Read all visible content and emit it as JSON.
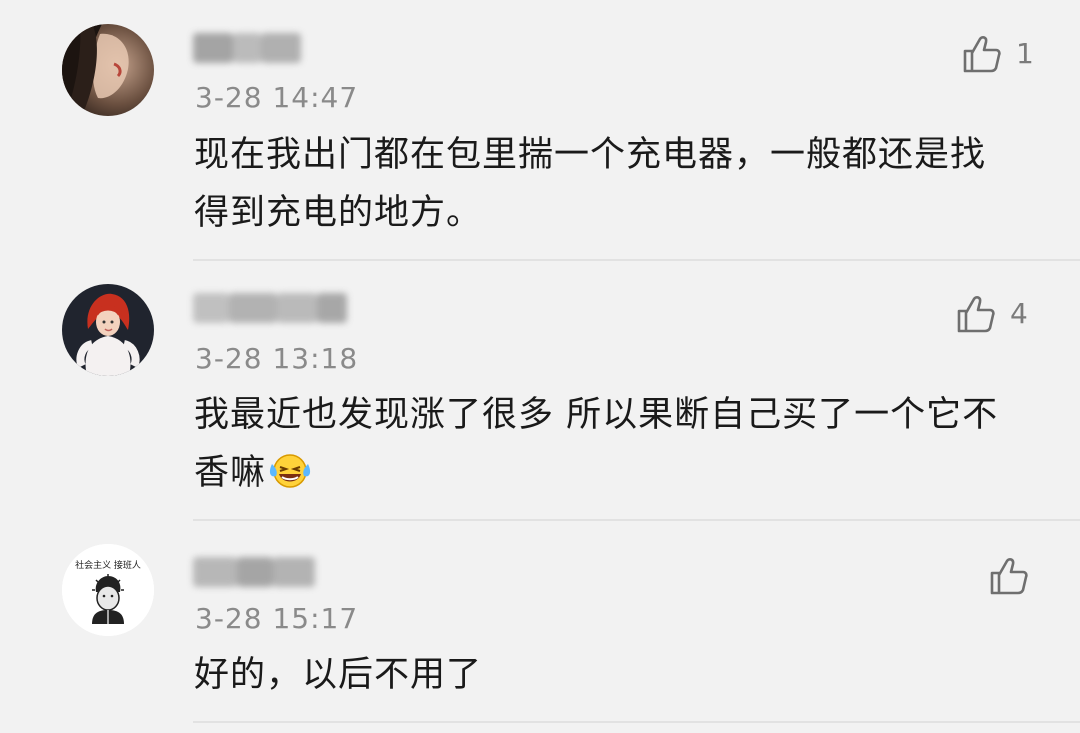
{
  "comments": [
    {
      "time": "3-28 14:47",
      "text": "现在我出门都在包里揣一个充电器，一般都还是找得到充电的地方。",
      "likes": "1"
    },
    {
      "time": "3-28 13:18",
      "text": "我最近也发现涨了很多 所以果断自己买了一个它不香嘛",
      "emoji": "laughing-crying-emoji",
      "likes": "4"
    },
    {
      "time": "3-28 15:17",
      "text": "好的，以后不用了",
      "likes": ""
    }
  ],
  "avatar3_text": "社会主义 接班人",
  "icons": {
    "like": "thumbs-up-icon"
  }
}
